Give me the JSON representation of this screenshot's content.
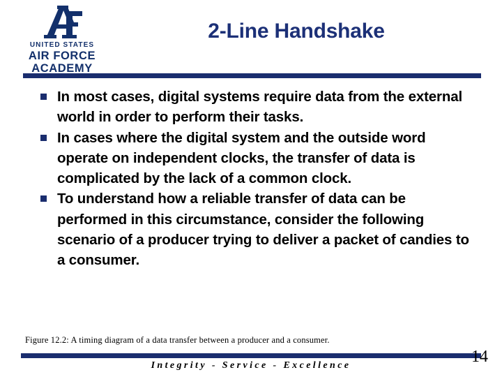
{
  "colors": {
    "navy_bar": "#1a2d6e",
    "title_navy": "#1c3077",
    "logo_navy": "#13306b",
    "body_text": "#000000",
    "background": "#ffffff"
  },
  "header": {
    "logo": {
      "monogram": "AF",
      "line1": "UNITED STATES",
      "line2": "AIR FORCE",
      "line3": "ACADEMY"
    },
    "title": "2-Line Handshake"
  },
  "body": {
    "bullets": [
      "In most cases, digital systems require data from the external world in order to perform their tasks.",
      "In cases where the digital system and the outside word operate on independent clocks, the transfer of data is complicated by the lack of a common clock.",
      "To understand how a reliable transfer of data can be performed in this circumstance, consider the following scenario of a producer trying to deliver a packet of candies to a consumer."
    ]
  },
  "figure": {
    "caption": "Figure 12.2: A timing diagram of a data transfer between a producer and a consumer."
  },
  "footer": {
    "tagline": "Integrity - Service - Excellence",
    "page_number": "14"
  }
}
